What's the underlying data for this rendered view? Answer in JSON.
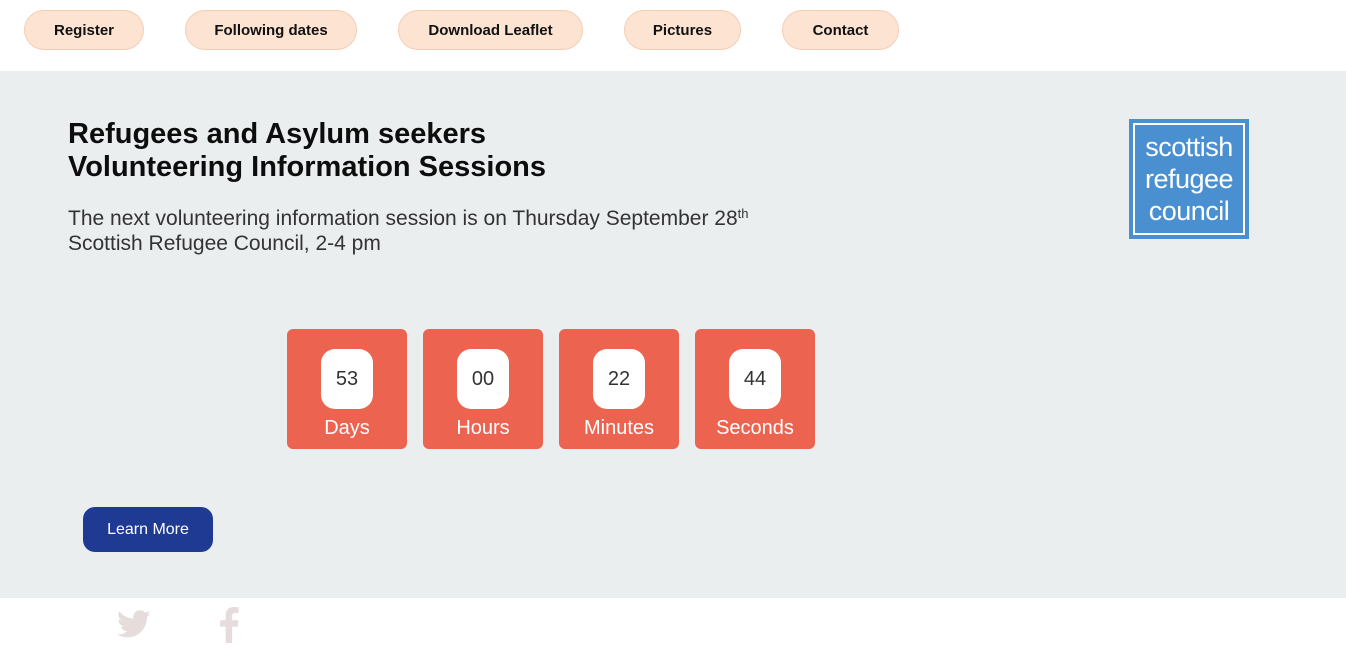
{
  "nav": {
    "items": [
      {
        "label": "Register"
      },
      {
        "label": "Following dates"
      },
      {
        "label": "Download Leaflet"
      },
      {
        "label": "Pictures"
      },
      {
        "label": "Contact"
      }
    ]
  },
  "hero": {
    "title_line1": "Refugees and Asylum seekers",
    "title_line2": "Volunteering Information Sessions",
    "subtitle_line1": "The next volunteering information session is on Thursday September 28",
    "subtitle_sup": "th",
    "subtitle_line2": "Scottish Refugee Council, 2-4 pm"
  },
  "logo": {
    "line1": "scottish",
    "line2": "refugee",
    "line3": "council"
  },
  "countdown": [
    {
      "value": "53",
      "label": "Days"
    },
    {
      "value": "00",
      "label": "Hours"
    },
    {
      "value": "22",
      "label": "Minutes"
    },
    {
      "value": "44",
      "label": "Seconds"
    }
  ],
  "cta": {
    "label": "Learn More"
  },
  "social": {
    "icons": [
      "twitter-icon",
      "facebook-icon"
    ],
    "icon_color": "#e6dcdc"
  },
  "colors": {
    "nav_button": "#fde3d1",
    "countdown": "#ec6450",
    "cta": "#1f3a93",
    "logo": "#4a8fd0",
    "main_bg": "#eaeeef"
  }
}
